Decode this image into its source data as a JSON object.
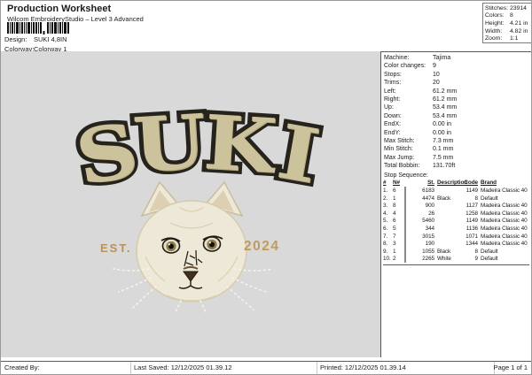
{
  "header": {
    "title": "Production Worksheet",
    "subtitle": "Wilcom EmbroideryStudio – Level 3 Advanced",
    "design_label": "Design:",
    "design_value": "SUKI 4,8IN",
    "colorway_label": "Colorway:",
    "colorway_value": "Colorway 1"
  },
  "stats": {
    "rows": [
      {
        "label": "Stitches:",
        "value": "23914"
      },
      {
        "label": "Colors:",
        "value": "8"
      },
      {
        "label": "Height:",
        "value": "4.21 in"
      },
      {
        "label": "Width:",
        "value": "4.82 in"
      },
      {
        "label": "Zoom:",
        "value": "1:1"
      }
    ]
  },
  "machine_info": {
    "rows": [
      {
        "label": "Machine:",
        "value": "Tajima"
      },
      {
        "label": "Color changes:",
        "value": "9"
      },
      {
        "label": "Stops:",
        "value": "10"
      },
      {
        "label": "Trims:",
        "value": "20"
      },
      {
        "label": "Left:",
        "value": "61.2 mm"
      },
      {
        "label": "Right:",
        "value": "61.2 mm"
      },
      {
        "label": "Up:",
        "value": "53.4 mm"
      },
      {
        "label": "Down:",
        "value": "53.4 mm"
      },
      {
        "label": "EndX:",
        "value": "0.00 in"
      },
      {
        "label": "EndY:",
        "value": "0.00 in"
      },
      {
        "label": "Max Stitch:",
        "value": "7.3 mm"
      },
      {
        "label": "Min Stitch:",
        "value": "0.1 mm"
      },
      {
        "label": "Max Jump:",
        "value": "7.5 mm"
      },
      {
        "label": "Total Bobbin:",
        "value": "131.70ft"
      }
    ]
  },
  "stop_sequence": {
    "title": "Stop Sequence:",
    "columns": [
      "#",
      "N#",
      "St.",
      "Description",
      "Code",
      "Brand"
    ],
    "rows": [
      {
        "num": "1.",
        "needle": "6",
        "swatch": "#d8ccb2",
        "thread": "6183",
        "description": "",
        "code": "1149",
        "brand": "Madeira Classic 40"
      },
      {
        "num": "2.",
        "needle": "1",
        "swatch": "#0d0d0d",
        "thread": "4474",
        "description": "Black",
        "code": "8",
        "brand": "Default"
      },
      {
        "num": "3.",
        "needle": "8",
        "swatch": "#d9c0ae",
        "thread": "900",
        "description": "",
        "code": "1127",
        "brand": "Madeira Classic 40"
      },
      {
        "num": "4.",
        "needle": "4",
        "swatch": "#6e4f3c",
        "thread": "26",
        "description": "",
        "code": "1258",
        "brand": "Madeira Classic 40"
      },
      {
        "num": "5.",
        "needle": "6",
        "swatch": "#d2c59e",
        "thread": "5460",
        "description": "",
        "code": "1149",
        "brand": "Madeira Classic 40"
      },
      {
        "num": "6.",
        "needle": "5",
        "swatch": "#93876f",
        "thread": "344",
        "description": "",
        "code": "1136",
        "brand": "Madeira Classic 40"
      },
      {
        "num": "7.",
        "needle": "7",
        "swatch": "#e9e3d3",
        "thread": "3015",
        "description": "",
        "code": "1071",
        "brand": "Madeira Classic 40"
      },
      {
        "num": "8.",
        "needle": "3",
        "swatch": "#8a6240",
        "thread": "190",
        "description": "",
        "code": "1344",
        "brand": "Madeira Classic 40"
      },
      {
        "num": "9.",
        "needle": "1",
        "swatch": "#0d0d0d",
        "thread": "1055",
        "description": "Black",
        "code": "8",
        "brand": "Default"
      },
      {
        "num": "10.",
        "needle": "2",
        "swatch": "#ffffff",
        "thread": "2265",
        "description": "White",
        "code": "9",
        "brand": "Default"
      }
    ]
  },
  "design": {
    "word": "SUKI",
    "letters": [
      "S",
      "U",
      "K",
      "I"
    ],
    "est": "EST.",
    "year": "2024",
    "colors": {
      "background": "#d9d9d9",
      "letter_fill": "#ccc29b",
      "letter_outline": "#26231c",
      "accent_text": "#bf9c5e",
      "cat_body": "#eee8d8"
    }
  },
  "footer": {
    "created_by": "Created By:",
    "last_saved": "Last Saved: 12/12/2025 01.39.12",
    "printed": "Printed: 12/12/2025 01.39.14",
    "page": "Page 1 of 1"
  }
}
